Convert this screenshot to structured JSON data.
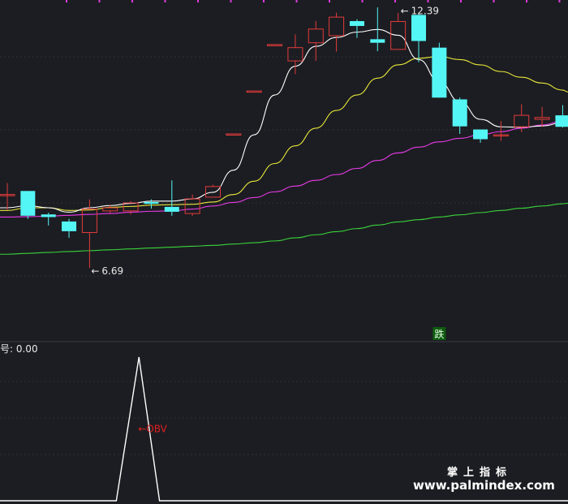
{
  "chart_data": [
    {
      "type": "candlestick",
      "panel": "price",
      "ylim": [
        5.5,
        12.6
      ],
      "colors": {
        "up": "#e23b3b",
        "down": "#54f5f5",
        "ma_short": "#ffffff",
        "ma_mid": "#e8e83a",
        "ma_long": "#e83ae8",
        "ma_longest": "#3ad43a"
      },
      "candles": [
        {
          "o": 8.35,
          "h": 8.61,
          "l": 8.0,
          "c": 8.35
        },
        {
          "o": 8.43,
          "h": 8.43,
          "l": 7.8,
          "c": 7.87
        },
        {
          "o": 7.9,
          "h": 7.94,
          "l": 7.65,
          "c": 7.84
        },
        {
          "o": 7.74,
          "h": 7.8,
          "l": 7.37,
          "c": 7.52
        },
        {
          "o": 7.49,
          "h": 8.24,
          "l": 6.69,
          "c": 8.02
        },
        {
          "o": 7.98,
          "h": 8.11,
          "l": 7.93,
          "c": 8.05
        },
        {
          "o": 7.98,
          "h": 8.2,
          "l": 7.9,
          "c": 8.16
        },
        {
          "o": 8.18,
          "h": 8.24,
          "l": 8.03,
          "c": 8.14
        },
        {
          "o": 8.07,
          "h": 8.67,
          "l": 7.87,
          "c": 7.96
        },
        {
          "o": 7.92,
          "h": 8.35,
          "l": 7.87,
          "c": 8.25
        },
        {
          "o": 8.29,
          "h": 8.57,
          "l": 8.29,
          "c": 8.53
        },
        {
          "o": 9.72,
          "h": 9.72,
          "l": 9.72,
          "c": 9.72
        },
        {
          "o": 10.69,
          "h": 10.69,
          "l": 10.69,
          "c": 10.69
        },
        {
          "o": 11.74,
          "h": 11.74,
          "l": 11.74,
          "c": 11.74
        },
        {
          "o": 11.37,
          "h": 11.97,
          "l": 11.07,
          "c": 11.67
        },
        {
          "o": 11.78,
          "h": 12.27,
          "l": 11.37,
          "c": 12.09
        },
        {
          "o": 11.94,
          "h": 12.46,
          "l": 11.58,
          "c": 12.36
        },
        {
          "o": 12.27,
          "h": 12.31,
          "l": 11.89,
          "c": 12.16
        },
        {
          "o": 11.86,
          "h": 12.58,
          "l": 11.59,
          "c": 11.78
        },
        {
          "o": 11.63,
          "h": 12.46,
          "l": 11.63,
          "c": 12.26
        },
        {
          "o": 12.41,
          "h": 12.46,
          "l": 11.34,
          "c": 11.82
        },
        {
          "o": 11.67,
          "h": 11.78,
          "l": 10.62,
          "c": 10.54
        },
        {
          "o": 10.5,
          "h": 10.54,
          "l": 9.72,
          "c": 9.89
        },
        {
          "o": 9.82,
          "h": 9.82,
          "l": 9.52,
          "c": 9.6
        },
        {
          "o": 9.7,
          "h": 10.01,
          "l": 9.56,
          "c": 9.7
        },
        {
          "o": 9.88,
          "h": 10.39,
          "l": 9.76,
          "c": 10.14
        },
        {
          "o": 10.05,
          "h": 10.33,
          "l": 9.88,
          "c": 10.09
        },
        {
          "o": 10.14,
          "h": 10.37,
          "l": 9.86,
          "c": 9.88
        }
      ],
      "ma_short": [
        8.05,
        8.1,
        8.05,
        7.95,
        8.05,
        8.1,
        8.15,
        8.2,
        8.2,
        8.25,
        8.4,
        8.9,
        9.7,
        10.6,
        11.25,
        11.7,
        11.9,
        12.02,
        12.08,
        11.95,
        11.4,
        10.9,
        10.45,
        10.05,
        9.88,
        9.87,
        9.9,
        9.97
      ],
      "ma_mid": [
        7.99,
        8.05,
        8.05,
        7.99,
        8.0,
        8.06,
        8.08,
        8.11,
        8.12,
        8.13,
        8.18,
        8.35,
        8.65,
        9.05,
        9.45,
        9.85,
        10.25,
        10.6,
        10.98,
        11.28,
        11.43,
        11.47,
        11.4,
        11.28,
        11.13,
        11.0,
        10.87,
        10.71
      ],
      "ma_long": [
        7.84,
        7.85,
        7.86,
        7.88,
        7.9,
        7.92,
        7.95,
        7.97,
        7.98,
        8.02,
        8.09,
        8.17,
        8.28,
        8.41,
        8.54,
        8.67,
        8.8,
        8.94,
        9.12,
        9.29,
        9.42,
        9.54,
        9.62,
        9.7,
        9.77,
        9.85,
        9.92,
        10.01
      ],
      "ma_longest": [
        7.0,
        7.02,
        7.04,
        7.06,
        7.08,
        7.1,
        7.12,
        7.14,
        7.16,
        7.18,
        7.2,
        7.23,
        7.26,
        7.3,
        7.37,
        7.44,
        7.51,
        7.58,
        7.66,
        7.73,
        7.78,
        7.84,
        7.89,
        7.94,
        7.99,
        8.04,
        8.09,
        8.14
      ],
      "annotations": [
        {
          "candle": 4,
          "value": 6.69,
          "text": "6.69"
        },
        {
          "candle": 19,
          "value": 12.46,
          "text": "12.39"
        }
      ],
      "signal": {
        "candle": 21,
        "text": "跌"
      }
    },
    {
      "type": "line",
      "panel": "indicator",
      "label": "号: 0.00",
      "ylim": [
        0,
        1
      ],
      "x_range": [
        0,
        28
      ],
      "points": [
        [
          -1,
          0
        ],
        [
          5.3,
          0
        ],
        [
          6.4,
          1
        ],
        [
          7.4,
          0
        ],
        [
          29,
          0
        ]
      ],
      "annotation": {
        "x": 6.4,
        "y": 0.5,
        "text": "←OBV"
      },
      "color": "#ffffff",
      "annotation_color": "#e02020"
    }
  ],
  "watermark": {
    "name": "掌上指标",
    "url": "www.palmindex.com"
  }
}
